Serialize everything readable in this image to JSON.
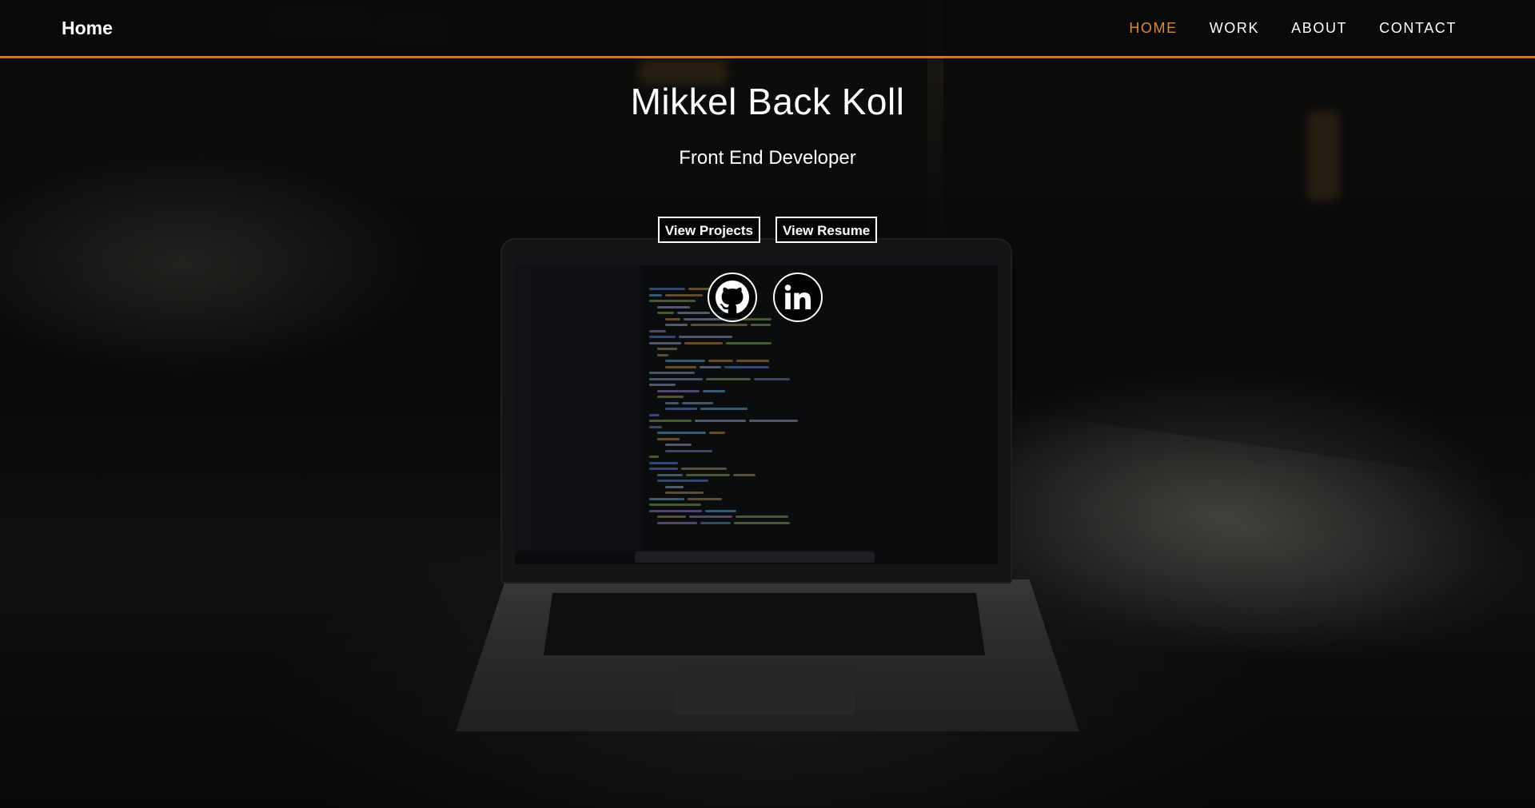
{
  "navbar": {
    "brand": "Home",
    "links": [
      "HOME",
      "WORK",
      "ABOUT",
      "CONTACT"
    ],
    "active_link": "HOME"
  },
  "hero": {
    "title": "Mikkel Back Koll",
    "subtitle": "Front End Developer",
    "buttons": {
      "projects": "View Projects",
      "resume": "View Resume"
    },
    "social": {
      "github": "github-icon",
      "linkedin": "linkedin-icon"
    }
  },
  "colors": {
    "accent": "#d48b3e",
    "nav_border": "#c77a33",
    "text": "#ffffff",
    "background": "#0b0b0b"
  }
}
